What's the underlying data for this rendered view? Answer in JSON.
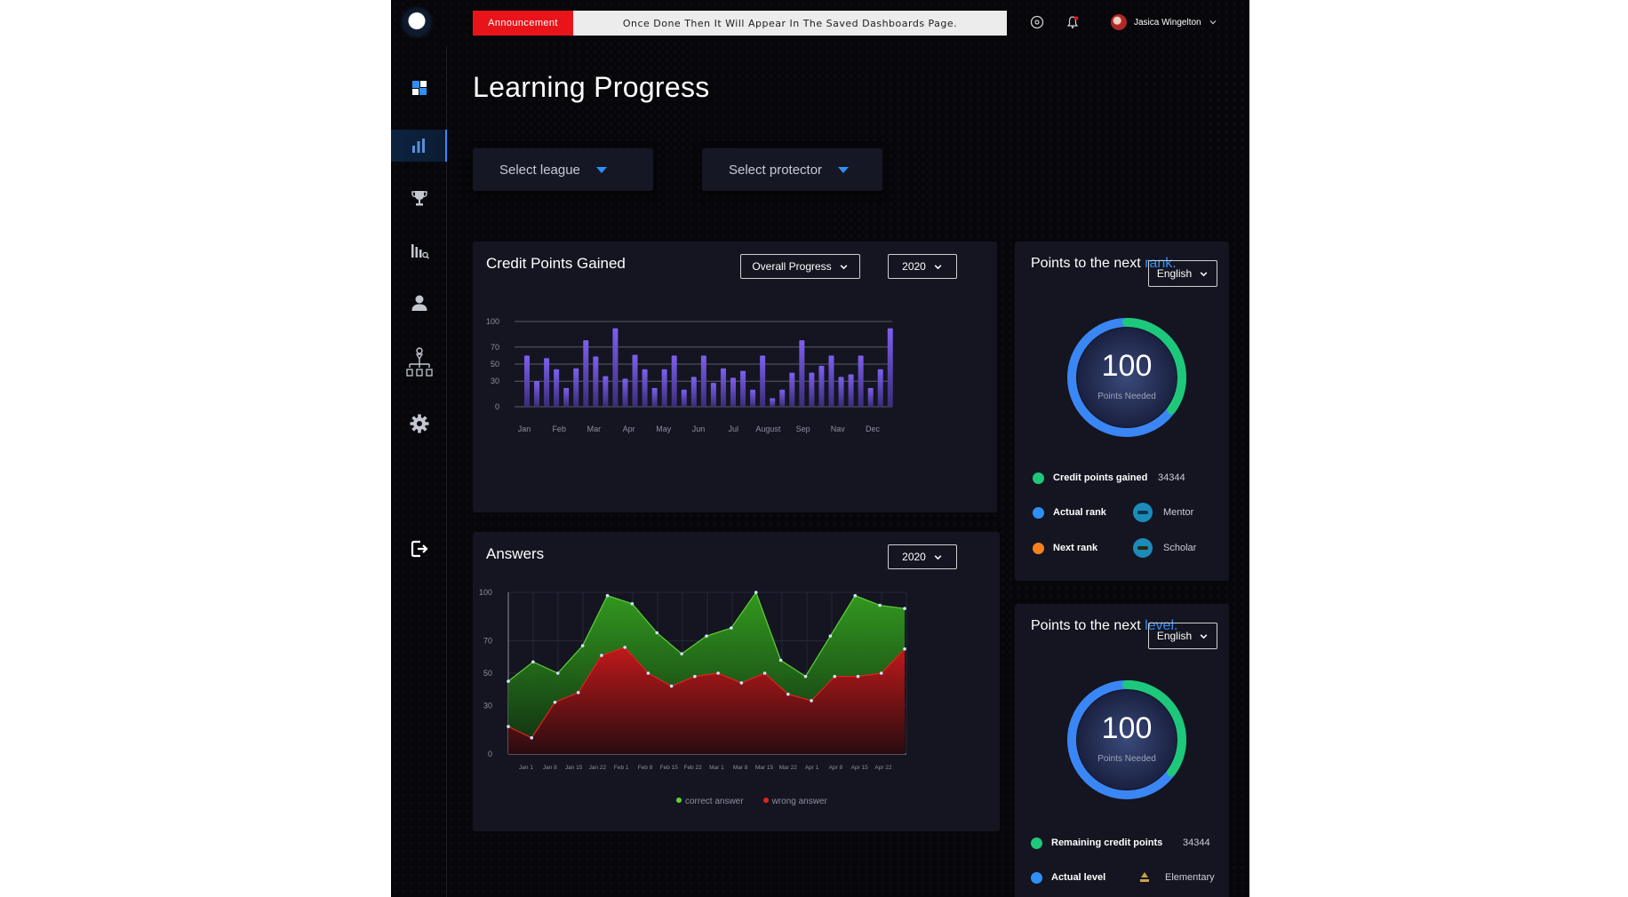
{
  "topbar": {
    "announcement_tag": "Announcement",
    "announcement_text": "Once Done Then It Will Appear In The Saved Dashboards Page.",
    "user_name": "Jasica Wingelton"
  },
  "sidebar": {
    "items": [
      {
        "name": "dashboard",
        "icon": "dashboard-icon",
        "active": false
      },
      {
        "name": "analytics",
        "icon": "bar-chart-icon",
        "active": true
      },
      {
        "name": "trophy",
        "icon": "trophy-icon",
        "active": false
      },
      {
        "name": "reports",
        "icon": "report-search-icon",
        "active": false
      },
      {
        "name": "profile",
        "icon": "user-icon",
        "active": false
      },
      {
        "name": "hierarchy",
        "icon": "org-chart-icon",
        "active": false
      },
      {
        "name": "settings",
        "icon": "gear-icon",
        "active": false
      }
    ],
    "logout_icon": "logout-icon"
  },
  "page": {
    "title": "Learning Progress",
    "select_league": "Select league",
    "select_protector": "Select protector"
  },
  "credit_card": {
    "title": "Credit Points Gained",
    "filter": "Overall Progress",
    "year": "2020"
  },
  "answers_card": {
    "title": "Answers",
    "year": "2020",
    "legend_correct": "correct answer",
    "legend_wrong": "wrong answer"
  },
  "rank_card": {
    "title_prefix": "Points to the next",
    "title_accent": "rank.",
    "language": "English",
    "ring_value": "100",
    "ring_label": "Points Needed",
    "ring_progress": 0.35,
    "rows": [
      {
        "label": "Credit points gained",
        "value": "34344",
        "color": "#1ec87a"
      },
      {
        "label": "Actual rank",
        "value": "Mentor",
        "color": "#2f8ff7"
      },
      {
        "label": "Next rank",
        "value": "Scholar",
        "color": "#f4801f"
      }
    ]
  },
  "level_card": {
    "title_prefix": "Points to the next",
    "title_accent": "level.",
    "language": "English",
    "ring_value": "100",
    "ring_label": "Points Needed",
    "ring_progress": 0.35,
    "rows": [
      {
        "label": "Remaining credit points",
        "value": "34344",
        "color": "#1ec87a"
      },
      {
        "label": "Actual level",
        "value": "Elementary",
        "color": "#2f8ff7"
      }
    ]
  },
  "chart_data": [
    {
      "type": "bar",
      "title": "Credit Points Gained",
      "categories": [
        "Jan",
        "Feb",
        "Mar",
        "Apr",
        "May",
        "Jun",
        "Jul",
        "August",
        "Sep",
        "Nav",
        "Dec"
      ],
      "yticks": [
        0,
        30,
        50,
        70,
        100
      ],
      "ylim": [
        0,
        100
      ],
      "values": [
        60,
        30,
        57,
        44,
        22,
        45,
        78,
        59,
        36,
        92,
        33,
        61,
        44,
        22,
        44,
        60,
        20,
        35,
        60,
        28,
        45,
        34,
        42,
        20,
        60,
        10,
        20,
        40,
        78,
        40,
        48,
        60,
        35,
        38,
        60,
        22,
        44,
        92
      ]
    },
    {
      "type": "area",
      "title": "Answers",
      "x": [
        "Jan 1",
        "Jan 8",
        "Jan 15",
        "Jan 22",
        "Feb 1",
        "Feb 8",
        "Feb 15",
        "Feb 22",
        "Mar 1",
        "Mar 8",
        "Mar 15",
        "Mar 22",
        "Apr 1",
        "Apr 8",
        "Apr 15",
        "Apr 22"
      ],
      "yticks": [
        0,
        30,
        50,
        70,
        100
      ],
      "ylim": [
        0,
        100
      ],
      "series": [
        {
          "name": "correct answer",
          "color": "#5fd13a",
          "values": [
            45,
            57,
            50,
            67,
            98,
            93,
            75,
            62,
            73,
            78,
            100,
            58,
            48,
            73,
            98,
            92,
            90
          ]
        },
        {
          "name": "wrong answer",
          "color": "#e0231e",
          "values": [
            17,
            10,
            32,
            38,
            61,
            66,
            50,
            42,
            48,
            50,
            44,
            50,
            37,
            33,
            48,
            48,
            50,
            65
          ]
        }
      ],
      "legend": "bottom"
    }
  ]
}
